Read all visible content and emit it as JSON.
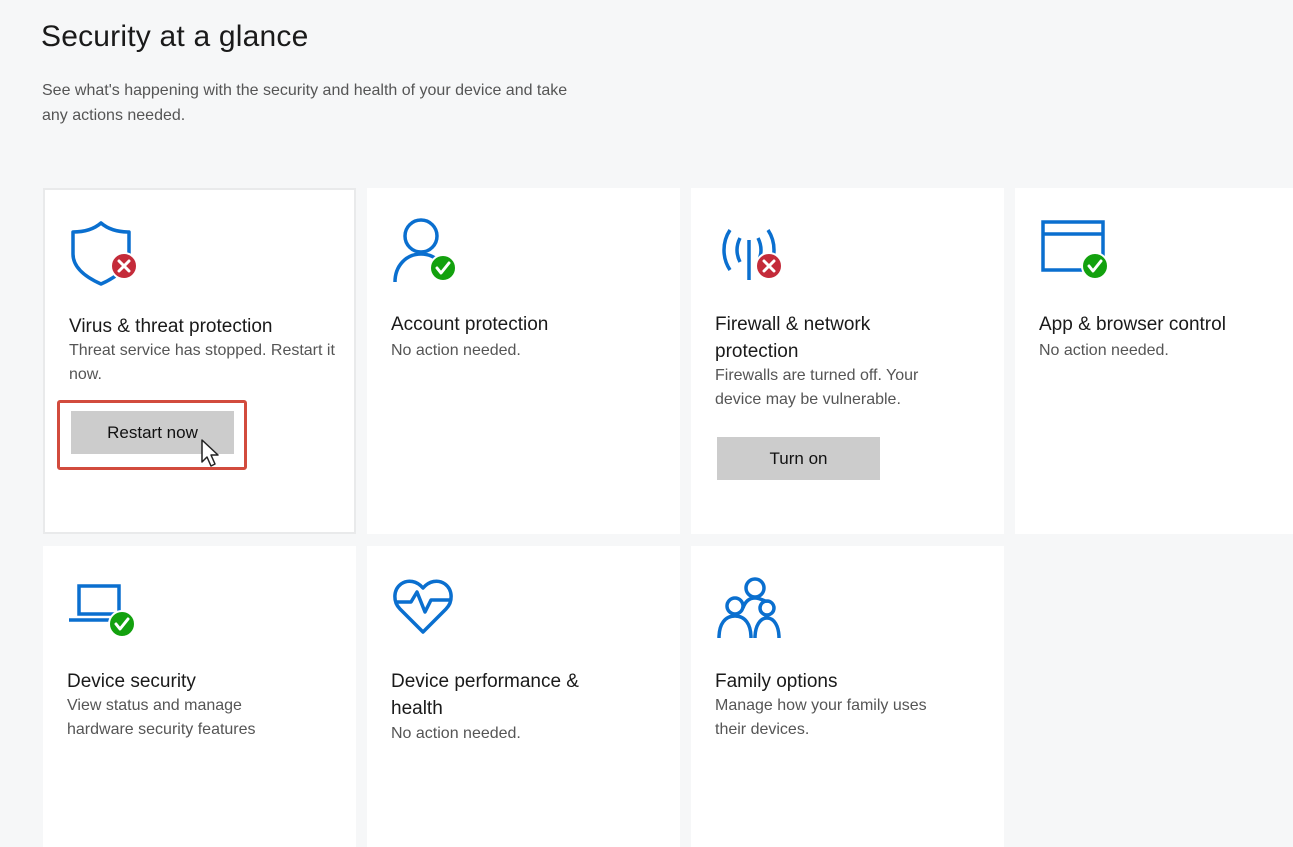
{
  "header": {
    "title": "Security at a glance",
    "subtitle": "See what's happening with the security and health of your device and take any actions needed."
  },
  "colors": {
    "accent": "#0a6fcf",
    "error": "#c42b3a",
    "ok": "#13a10e",
    "button_bg": "#cccccc",
    "highlight_border": "#d24b3d"
  },
  "tiles": [
    {
      "title": "Virus & threat protection",
      "description": "Threat service has stopped. Restart it now.",
      "icon": "shield-icon",
      "status": "error",
      "button": "Restart now"
    },
    {
      "title": "Account protection",
      "description": "No action needed.",
      "icon": "person-icon",
      "status": "ok"
    },
    {
      "title": "Firewall & network protection",
      "description": "Firewalls are turned off. Your device may be vulnerable.",
      "icon": "antenna-icon",
      "status": "error",
      "button": "Turn on"
    },
    {
      "title": "App & browser control",
      "description": "No action needed.",
      "icon": "browser-window-icon",
      "status": "ok"
    },
    {
      "title": "Device security",
      "description": "View status and manage hardware security features",
      "icon": "laptop-icon",
      "status": "ok"
    },
    {
      "title": "Device performance & health",
      "description": "No action needed.",
      "icon": "heart-pulse-icon"
    },
    {
      "title": "Family options",
      "description": "Manage how your family uses their devices.",
      "icon": "family-icon"
    }
  ]
}
